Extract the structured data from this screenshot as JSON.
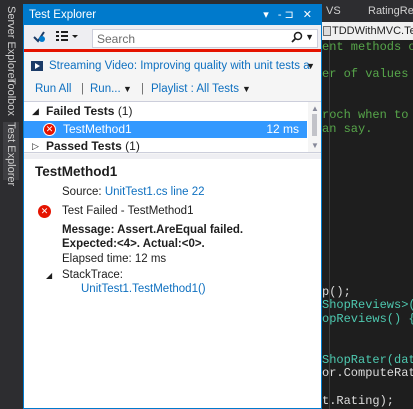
{
  "side_tabs": [
    "Server Explorer",
    "Toolbox",
    "Test Explorer"
  ],
  "panel": {
    "title": "Test Explorer",
    "title_icons": "▾ -⊐ ✕",
    "search_placeholder": "Search",
    "streaming": "Streaming Video: Improving quality with unit tests a",
    "run_all": "Run All",
    "run": "Run...",
    "playlist": "Playlist : All Tests"
  },
  "tree": {
    "failed_label": "Failed Tests",
    "failed_count": "(1)",
    "passed_label": "Passed Tests",
    "passed_count": "(1)",
    "selected_name": "TestMethod1",
    "selected_time": "12 ms"
  },
  "details": {
    "name": "TestMethod1",
    "source_label": "Source:",
    "source_link": "UnitTest1.cs line 22",
    "status": "Test Failed - TestMethod1",
    "message_line1": "Message: Assert.AreEqual failed.",
    "message_line2": "Expected:<4>. Actual:<0>.",
    "elapsed": "Elapsed time: 12 ms",
    "stacktrace_label": "StackTrace:",
    "stack_frame": "UnitTest1.TestMethod1()"
  },
  "editor": {
    "tab_vs": "VS",
    "tab_rating": "RatingRe",
    "path": "TDDWithMVC.Tes",
    "lines": [
      {
        "text": "ent methods o",
        "color": "green"
      },
      {
        "text": "",
        "color": "white"
      },
      {
        "text": "er of values",
        "color": "green"
      },
      {
        "text": "",
        "color": "white"
      },
      {
        "text": "",
        "color": "white"
      },
      {
        "text": "roch when to",
        "color": "green"
      },
      {
        "text": "an say.",
        "color": "green"
      },
      {
        "text": "",
        "color": "white"
      },
      {
        "text": "",
        "color": "white"
      },
      {
        "text": "",
        "color": "white"
      },
      {
        "text": "",
        "color": "white"
      },
      {
        "text": "",
        "color": "white"
      },
      {
        "text": "",
        "color": "white"
      },
      {
        "text": "",
        "color": "white"
      },
      {
        "text": "",
        "color": "white"
      },
      {
        "text": "",
        "color": "white"
      },
      {
        "text": "",
        "color": "white"
      },
      {
        "text": "",
        "color": "white"
      },
      {
        "text": "p();",
        "color": "white"
      },
      {
        "text": "ShopReviews>(",
        "color": "teal"
      },
      {
        "text": "opReviews() {",
        "color": "teal"
      },
      {
        "text": "",
        "color": "white"
      },
      {
        "text": "",
        "color": "white"
      },
      {
        "text": "ShopRater(dat",
        "color": "teal"
      },
      {
        "text": "or.ComputeRat",
        "color": "white"
      },
      {
        "text": "",
        "color": "white"
      },
      {
        "text": "t.Rating);",
        "color": "white"
      }
    ]
  }
}
